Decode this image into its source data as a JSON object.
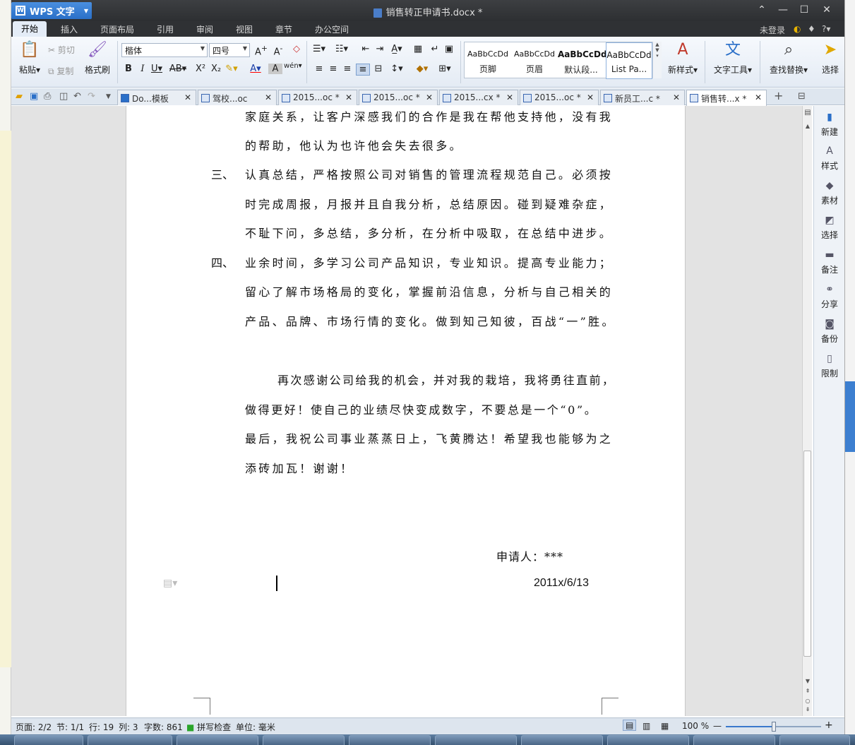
{
  "app": {
    "name": "WPS 文字",
    "document_title": "销售转正申请书.docx *"
  },
  "menu": {
    "items": [
      "开始",
      "插入",
      "页面布局",
      "引用",
      "审阅",
      "视图",
      "章节",
      "办公空间"
    ],
    "login": "未登录",
    "help": "?"
  },
  "ribbon": {
    "paste": "粘贴",
    "cut": "剪切",
    "copy": "复制",
    "format_painter": "格式刷",
    "font_name": "楷体",
    "font_size": "四号",
    "styles": [
      {
        "sample": "AaBbCcDd",
        "name": "页脚"
      },
      {
        "sample": "AaBbCcDd",
        "name": "页眉"
      },
      {
        "sample": "AaBbCcDd",
        "name": "默认段..."
      },
      {
        "sample": "AaBbCcDd",
        "name": "List Pa..."
      }
    ],
    "new_style": "新样式",
    "text_tools": "文字工具",
    "find_replace": "查找替换",
    "select": "选择"
  },
  "tabs": [
    {
      "label": "Do...模板"
    },
    {
      "label": "驾校...oc"
    },
    {
      "label": "2015...oc *"
    },
    {
      "label": "2015...oc *"
    },
    {
      "label": "2015...cx *"
    },
    {
      "label": "2015...oc *"
    },
    {
      "label": "新员工...c *"
    },
    {
      "label": "销售转...x *"
    }
  ],
  "document": {
    "lines": [
      "家庭关系，让客户深感我们的合作是我在帮他支持他，没有我",
      "的帮助，他认为也许他会失去很多。",
      "认真总结，严格按照公司对销售的管理流程规范自己。必须按",
      "时完成周报，月报并且自我分析，总结原因。碰到疑难杂症，",
      "不耻下问，多总结，多分析，在分析中吸取，在总结中进步。",
      "业余时间，多学习公司产品知识，专业知识。提高专业能力；",
      "留心了解市场格局的变化，掌握前沿信息，分析与自己相关的",
      "产品、品牌、市场行情的变化。做到知己知彼，百战“一”胜。",
      "再次感谢公司给我的机会，并对我的栽培，我将勇往直前，",
      "做得更好！使自己的业绩尽快变成数字，不要总是一个“0”。",
      "最后，我祝公司事业蒸蒸日上，飞黄腾达！希望我也能够为之",
      "添砖加瓦！谢谢！"
    ],
    "numbers": [
      "三、",
      "四、"
    ],
    "applicant": "申请人：***",
    "date": "2011x/6/13"
  },
  "sidepanel": [
    "新建",
    "样式",
    "素材",
    "选择",
    "备注",
    "分享",
    "备份",
    "限制"
  ],
  "status": {
    "page": "页面: 2/2",
    "section": "节: 1/1",
    "row": "行: 19",
    "col": "列: 3",
    "words": "字数: 861",
    "spell": "拼写检查",
    "unit": "单位: 毫米",
    "zoom": "100 %",
    "zoom_level_percent": 50
  },
  "colors": {
    "accent": "#2a6fc8",
    "titlebar": "#2d2f32"
  }
}
